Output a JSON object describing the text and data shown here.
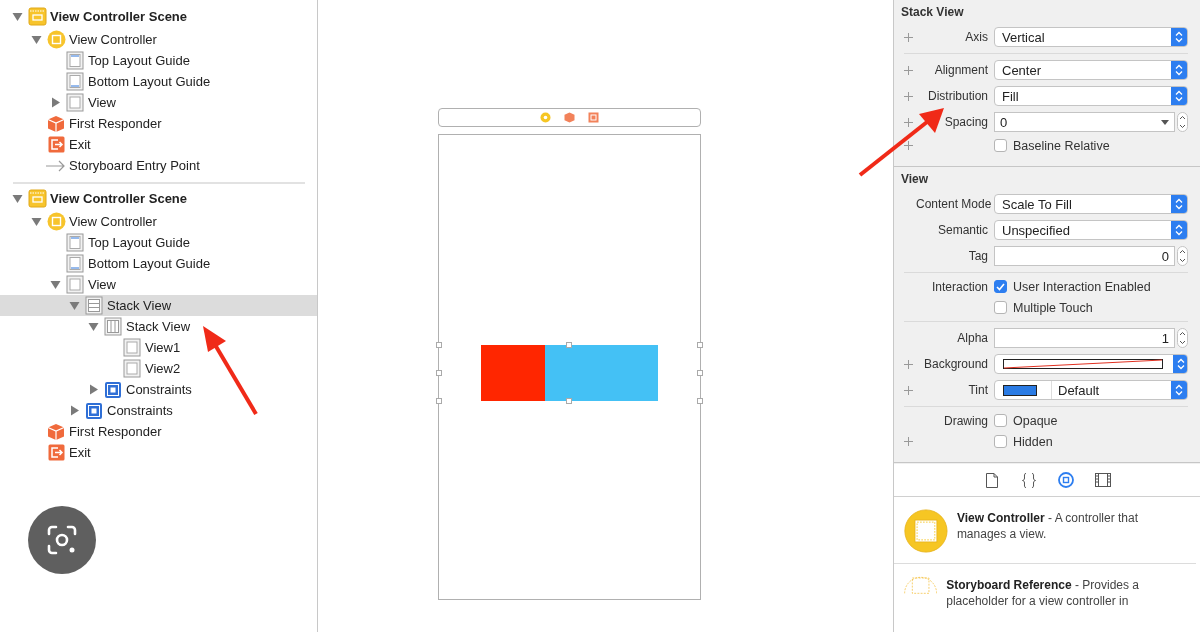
{
  "outline": [
    {
      "kind": "scene",
      "label": "View Controller Scene",
      "expanded": true,
      "selected": false,
      "children": [
        {
          "kind": "controller",
          "label": "View Controller",
          "expanded": true,
          "selected": false,
          "children": [
            {
              "kind": "top-guide",
              "label": "Top Layout Guide",
              "selected": false
            },
            {
              "kind": "bottom-guide",
              "label": "Bottom Layout Guide",
              "selected": false
            },
            {
              "kind": "view",
              "label": "View",
              "expanded": false,
              "selected": false
            }
          ]
        },
        {
          "kind": "responder",
          "label": "First Responder",
          "selected": false
        },
        {
          "kind": "exit",
          "label": "Exit",
          "selected": false
        },
        {
          "kind": "entry",
          "label": "Storyboard Entry Point",
          "selected": false
        }
      ]
    },
    {
      "kind": "scene",
      "label": "View Controller Scene",
      "expanded": true,
      "selected": false,
      "children": [
        {
          "kind": "controller",
          "label": "View Controller",
          "expanded": true,
          "selected": false,
          "children": [
            {
              "kind": "top-guide",
              "label": "Top Layout Guide",
              "selected": false
            },
            {
              "kind": "bottom-guide",
              "label": "Bottom Layout Guide",
              "selected": false
            },
            {
              "kind": "view",
              "label": "View",
              "expanded": true,
              "selected": false,
              "children": [
                {
                  "kind": "vstack",
                  "label": "Stack View",
                  "expanded": true,
                  "selected": true,
                  "children": [
                    {
                      "kind": "hstack",
                      "label": "Stack View",
                      "expanded": true,
                      "selected": false,
                      "children": [
                        {
                          "kind": "view",
                          "label": "View1",
                          "selected": false
                        },
                        {
                          "kind": "view",
                          "label": "View2",
                          "selected": false
                        }
                      ]
                    },
                    {
                      "kind": "constraints",
                      "label": "Constraints",
                      "expanded": false,
                      "selected": false
                    }
                  ]
                },
                {
                  "kind": "constraints",
                  "label": "Constraints",
                  "expanded": false,
                  "selected": false
                }
              ]
            }
          ]
        },
        {
          "kind": "responder",
          "label": "First Responder",
          "selected": false
        },
        {
          "kind": "exit",
          "label": "Exit",
          "selected": false
        }
      ]
    }
  ],
  "canvas": {
    "arranged_views": [
      {
        "color": "#ff2600"
      },
      {
        "color": "#44c1f5"
      }
    ]
  },
  "inspector": [
    {
      "title": "Stack View",
      "groups": [
        [
          {
            "kind": "popup",
            "label": "Axis",
            "value": "Vertical",
            "plus": true
          }
        ],
        [
          {
            "kind": "popup",
            "label": "Alignment",
            "value": "Center",
            "plus": true
          },
          {
            "kind": "popup",
            "label": "Distribution",
            "value": "Fill",
            "plus": true
          },
          {
            "kind": "combo",
            "label": "Spacing",
            "value": "0",
            "plus": true
          },
          {
            "kind": "checkbox",
            "text": "Baseline Relative",
            "checked": false,
            "plus": true
          }
        ]
      ]
    },
    {
      "title": "View",
      "groups": [
        [
          {
            "kind": "popup",
            "label": "Content Mode",
            "value": "Scale To Fill",
            "plus": false
          },
          {
            "kind": "popup",
            "label": "Semantic",
            "value": "Unspecified",
            "plus": false
          },
          {
            "kind": "stepper",
            "label": "Tag",
            "value": "0",
            "plus": false
          }
        ],
        [
          {
            "kind": "checkbox",
            "label": "Interaction",
            "text": "User Interaction Enabled",
            "checked": true,
            "plus": false
          },
          {
            "kind": "checkbox",
            "text": "Multiple Touch",
            "checked": false,
            "plus": false
          }
        ],
        [
          {
            "kind": "stepper",
            "label": "Alpha",
            "value": "1",
            "plus": false
          },
          {
            "kind": "clear-color",
            "label": "Background",
            "plus": true
          },
          {
            "kind": "color",
            "label": "Tint",
            "value": "Default",
            "color": "#2a7be4",
            "plus": true
          }
        ],
        [
          {
            "kind": "checkbox",
            "label": "Drawing",
            "text": "Opaque",
            "checked": false,
            "plus": false
          },
          {
            "kind": "checkbox",
            "text": "Hidden",
            "checked": false,
            "plus": true
          }
        ]
      ]
    }
  ],
  "library_tabs": [
    {
      "kind": "file",
      "selected": false
    },
    {
      "kind": "code",
      "selected": false
    },
    {
      "kind": "object",
      "selected": true
    },
    {
      "kind": "media",
      "selected": false
    }
  ],
  "library": [
    {
      "kind": "controller",
      "description": "**View Controller** - A controller that manages a view."
    },
    {
      "kind": "reference",
      "description": "**Storyboard Reference** - Provides a placeholder for a view controller in"
    }
  ]
}
